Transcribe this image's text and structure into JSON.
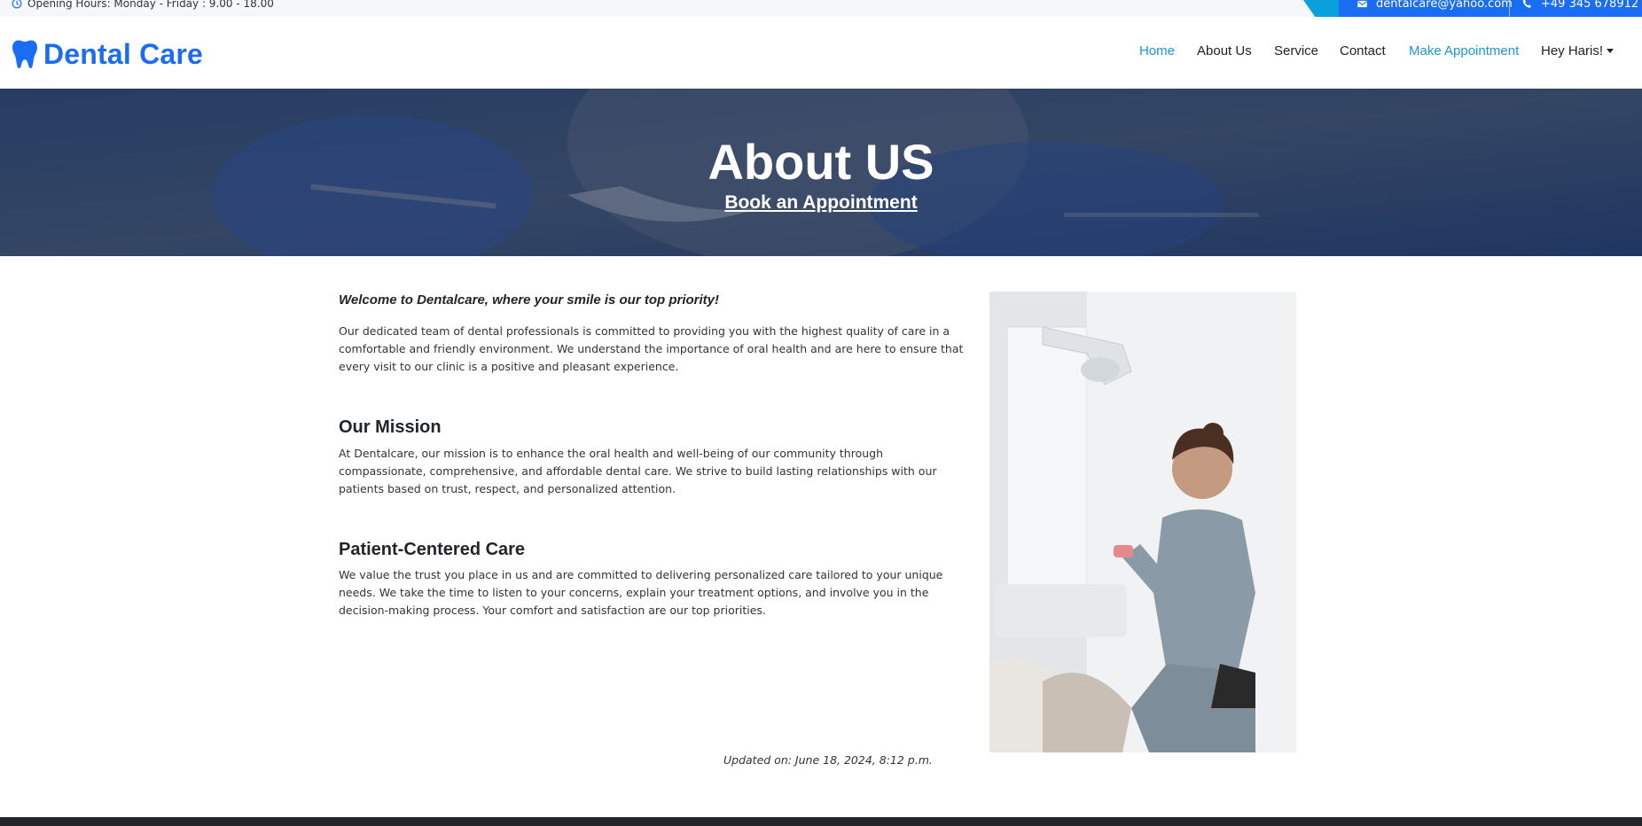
{
  "topbar": {
    "hours": "Opening Hours: Monday - Friday : 9.00 - 18.00",
    "email": "dentalcare@yahoo.com",
    "phone": "+49 345 678912"
  },
  "brand": {
    "name": "Dental Care",
    "icon": "tooth-icon",
    "color": "#1a6df3"
  },
  "nav": {
    "items": [
      {
        "label": "Home",
        "active": true
      },
      {
        "label": "About Us"
      },
      {
        "label": "Service"
      },
      {
        "label": "Contact"
      },
      {
        "label": "Make Appointment"
      },
      {
        "label": "Hey Haris!"
      }
    ]
  },
  "hero": {
    "title": "About US",
    "cta": "Book an Appointment"
  },
  "content": {
    "welcome": "Welcome to Dentalcare, where your smile is our top priority!",
    "intro": "Our dedicated team of dental professionals is committed to providing you with the highest quality of care in a comfortable and friendly environment. We understand the importance of oral health and are here to ensure that every visit to our clinic is a positive and pleasant experience.",
    "sections": [
      {
        "title": "Our Mission",
        "body": "At Dentalcare, our mission is to enhance the oral health and well-being of our community through compassionate, comprehensive, and affordable dental care. We strive to build lasting relationships with our patients based on trust, respect, and personalized attention."
      },
      {
        "title": "Patient-Centered Care",
        "body": "We value the trust you place in us and are committed to delivering personalized care tailored to your unique needs. We take the time to listen to your concerns, explain your treatment options, and involve you in the decision-making process. Your comfort and satisfaction are our top priorities."
      }
    ],
    "updated": "Updated on: June 18, 2024, 8:12 p.m."
  },
  "colors": {
    "accent": "#1a6df3",
    "link_active": "#1a98d5",
    "footer": "#212529"
  }
}
